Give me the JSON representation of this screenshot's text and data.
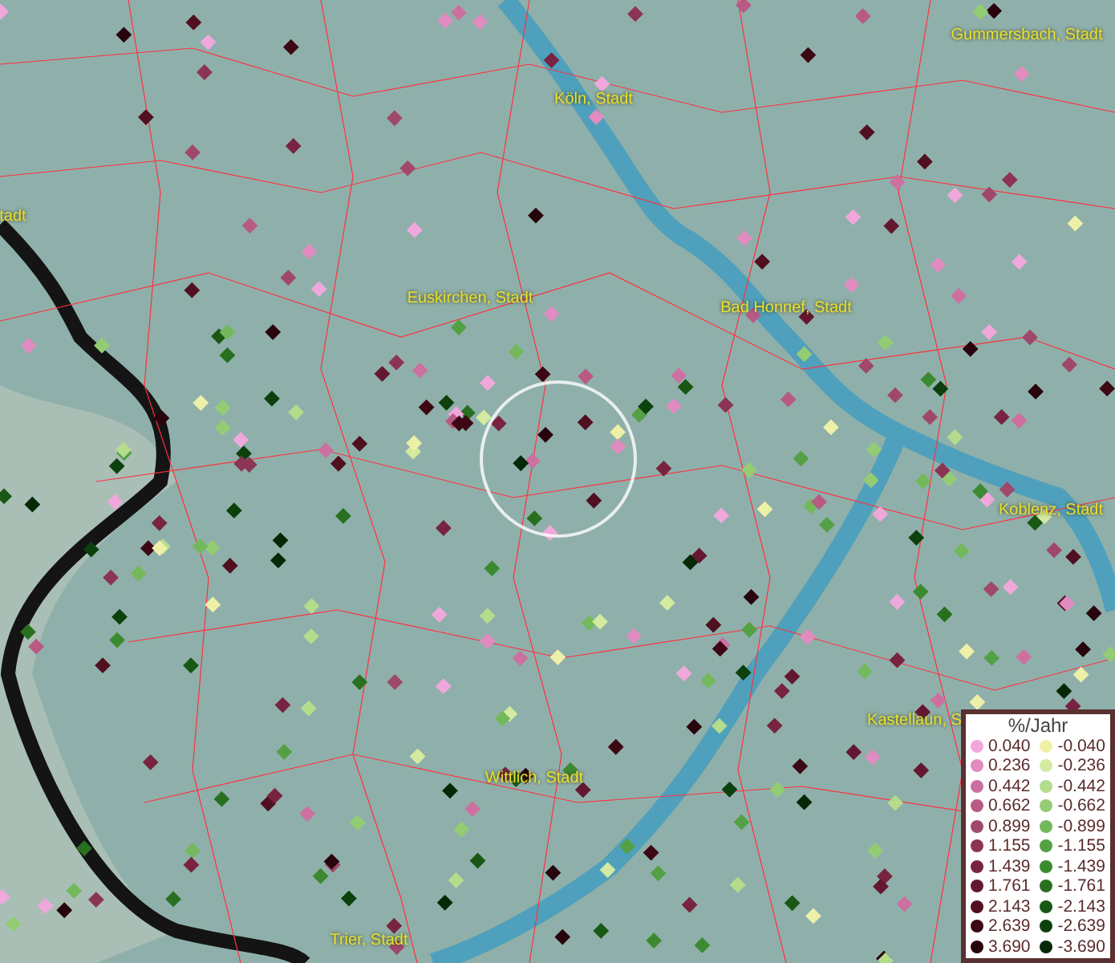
{
  "map": {
    "place_labels": [
      "Gummersbach, Stadt",
      "Köln, Stadt",
      "tadt",
      "Euskirchen, Stadt",
      "Bad Honnef, Stadt",
      "Koblenz, Stadt",
      "Kastellaun, S",
      "Wittlich, Stadt",
      "Trier, Stadt"
    ]
  },
  "legend": {
    "title": "%/Jahr",
    "positive": [
      {
        "label": "0.040",
        "color": "#f0a8dc"
      },
      {
        "label": "0.236",
        "color": "#e08cc0"
      },
      {
        "label": "0.442",
        "color": "#cc70a0"
      },
      {
        "label": "0.662",
        "color": "#b85a84"
      },
      {
        "label": "0.899",
        "color": "#a0486c"
      },
      {
        "label": "1.155",
        "color": "#8c3454"
      },
      {
        "label": "1.439",
        "color": "#782440"
      },
      {
        "label": "1.761",
        "color": "#641830"
      },
      {
        "label": "2.143",
        "color": "#501020"
      },
      {
        "label": "2.639",
        "color": "#3c0814"
      },
      {
        "label": "3.690",
        "color": "#28040c"
      }
    ],
    "negative": [
      {
        "label": "-0.040",
        "color": "#eef0a8"
      },
      {
        "label": "-0.236",
        "color": "#d4eaa0"
      },
      {
        "label": "-0.442",
        "color": "#b4dc8c"
      },
      {
        "label": "-0.662",
        "color": "#94cc74"
      },
      {
        "label": "-0.899",
        "color": "#74b85c"
      },
      {
        "label": "-1.155",
        "color": "#54a044"
      },
      {
        "label": "-1.439",
        "color": "#3c8a30"
      },
      {
        "label": "-1.761",
        "color": "#287020"
      },
      {
        "label": "-2.143",
        "color": "#185814"
      },
      {
        "label": "-2.639",
        "color": "#0c400c"
      },
      {
        "label": "-3.690",
        "color": "#062806"
      }
    ]
  }
}
